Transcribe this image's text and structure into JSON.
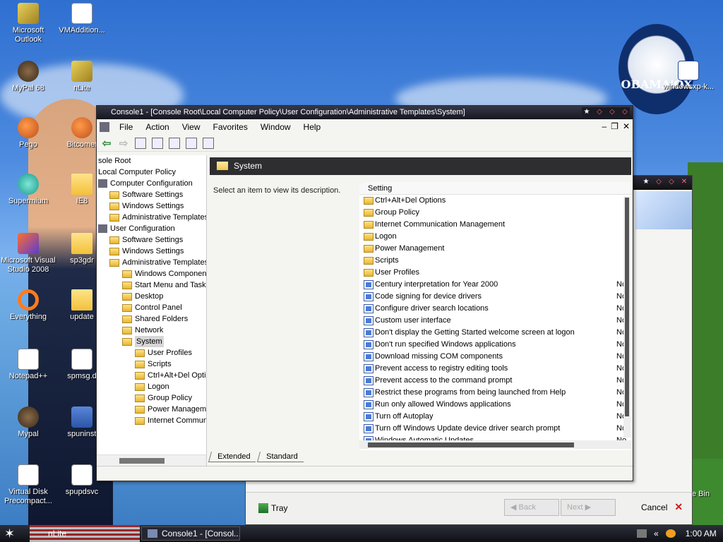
{
  "desktop": {
    "icons": [
      {
        "label": "Microsoft Outlook",
        "icon": "outlook-icon"
      },
      {
        "label": "VMAddition...",
        "icon": "document-icon"
      },
      {
        "label": "MyPal 68",
        "icon": "raccoon-icon"
      },
      {
        "label": "nLite",
        "icon": "nlite-icon"
      },
      {
        "label": "Pego",
        "icon": "app-icon"
      },
      {
        "label": "Bitcomet",
        "icon": "bitcomet-icon"
      },
      {
        "label": "Supermium",
        "icon": "browser-icon"
      },
      {
        "label": "IE8",
        "icon": "folder-icon"
      },
      {
        "label": "Microsoft Visual Studio 2008",
        "icon": "visual-studio-icon"
      },
      {
        "label": "sp3gdr",
        "icon": "folder-icon"
      },
      {
        "label": "Everything",
        "icon": "everything-icon"
      },
      {
        "label": "update",
        "icon": "folder-icon"
      },
      {
        "label": "Notepad++",
        "icon": "notepad-icon"
      },
      {
        "label": "spmsg.d",
        "icon": "document-icon"
      },
      {
        "label": "Mypal",
        "icon": "raccoon-icon"
      },
      {
        "label": "spuninst",
        "icon": "installer-icon"
      },
      {
        "label": "Virtual Disk Precompact...",
        "icon": "document-icon"
      },
      {
        "label": "spupdsvc",
        "icon": "window-icon"
      }
    ],
    "obama_logo": "OBAMA'OX",
    "obama_window_label": "windowsxp-k...",
    "recycle_label": "e Bin"
  },
  "mmc": {
    "title": "Console1 - [Console Root\\Local Computer Policy\\User Configuration\\Administrative Templates\\System]",
    "menu": [
      "File",
      "Action",
      "View",
      "Favorites",
      "Window",
      "Help"
    ],
    "tree": [
      {
        "label": "sole Root",
        "indent": 0,
        "kind": "none"
      },
      {
        "label": "Local Computer Policy",
        "indent": 0,
        "kind": "none"
      },
      {
        "label": "Computer Configuration",
        "indent": 0,
        "kind": "computer"
      },
      {
        "label": "Software Settings",
        "indent": 1,
        "kind": "folder"
      },
      {
        "label": "Windows Settings",
        "indent": 1,
        "kind": "folder"
      },
      {
        "label": "Administrative Templates",
        "indent": 1,
        "kind": "folder"
      },
      {
        "label": "User Configuration",
        "indent": 0,
        "kind": "user"
      },
      {
        "label": "Software Settings",
        "indent": 1,
        "kind": "folder"
      },
      {
        "label": "Windows Settings",
        "indent": 1,
        "kind": "folder"
      },
      {
        "label": "Administrative Templates",
        "indent": 1,
        "kind": "folder"
      },
      {
        "label": "Windows Components",
        "indent": 2,
        "kind": "folder"
      },
      {
        "label": "Start Menu and Taskbar",
        "indent": 2,
        "kind": "folder"
      },
      {
        "label": "Desktop",
        "indent": 2,
        "kind": "folder"
      },
      {
        "label": "Control Panel",
        "indent": 2,
        "kind": "folder"
      },
      {
        "label": "Shared Folders",
        "indent": 2,
        "kind": "folder"
      },
      {
        "label": "Network",
        "indent": 2,
        "kind": "folder"
      },
      {
        "label": "System",
        "indent": 2,
        "kind": "folder-selected"
      },
      {
        "label": "User Profiles",
        "indent": 3,
        "kind": "folder"
      },
      {
        "label": "Scripts",
        "indent": 3,
        "kind": "folder"
      },
      {
        "label": "Ctrl+Alt+Del Options",
        "indent": 3,
        "kind": "folder"
      },
      {
        "label": "Logon",
        "indent": 3,
        "kind": "folder"
      },
      {
        "label": "Group Policy",
        "indent": 3,
        "kind": "folder"
      },
      {
        "label": "Power Management",
        "indent": 3,
        "kind": "folder"
      },
      {
        "label": "Internet Communication",
        "indent": 3,
        "kind": "folder"
      }
    ],
    "header_title": "System",
    "description": "Select an item to view its description.",
    "list_header": "Setting",
    "list": [
      {
        "label": "Ctrl+Alt+Del Options",
        "kind": "folder",
        "state": ""
      },
      {
        "label": "Group Policy",
        "kind": "folder",
        "state": ""
      },
      {
        "label": "Internet Communication Management",
        "kind": "folder",
        "state": ""
      },
      {
        "label": "Logon",
        "kind": "folder",
        "state": ""
      },
      {
        "label": "Power Management",
        "kind": "folder",
        "state": ""
      },
      {
        "label": "Scripts",
        "kind": "folder",
        "state": ""
      },
      {
        "label": "User Profiles",
        "kind": "folder",
        "state": ""
      },
      {
        "label": "Century interpretation for Year 2000",
        "kind": "setting",
        "state": "No"
      },
      {
        "label": "Code signing for device drivers",
        "kind": "setting",
        "state": "No"
      },
      {
        "label": "Configure driver search locations",
        "kind": "setting",
        "state": "No"
      },
      {
        "label": "Custom user interface",
        "kind": "setting",
        "state": "No"
      },
      {
        "label": "Don't display the Getting Started welcome screen at logon",
        "kind": "setting",
        "state": "No"
      },
      {
        "label": "Don't run specified Windows applications",
        "kind": "setting",
        "state": "No"
      },
      {
        "label": "Download missing COM components",
        "kind": "setting",
        "state": "No"
      },
      {
        "label": "Prevent access to registry editing tools",
        "kind": "setting",
        "state": "No"
      },
      {
        "label": "Prevent access to the command prompt",
        "kind": "setting",
        "state": "No"
      },
      {
        "label": "Restrict these programs from being launched from Help",
        "kind": "setting",
        "state": "No"
      },
      {
        "label": "Run only allowed Windows applications",
        "kind": "setting",
        "state": "No"
      },
      {
        "label": "Turn off Autoplay",
        "kind": "setting",
        "state": "No"
      },
      {
        "label": "Turn off Windows Update device driver search prompt",
        "kind": "setting",
        "state": "No"
      },
      {
        "label": "Windows Automatic Updates",
        "kind": "setting",
        "state": "No"
      }
    ],
    "tabs": [
      "Extended",
      "Standard"
    ]
  },
  "win2": {
    "tray_label": "Tray",
    "back_label": "Back",
    "next_label": "Next",
    "cancel_label": "Cancel"
  },
  "taskbar": {
    "pinned_label": "nLite",
    "task_label": "Console1 - [Consol...",
    "clock": "1:00 AM"
  }
}
